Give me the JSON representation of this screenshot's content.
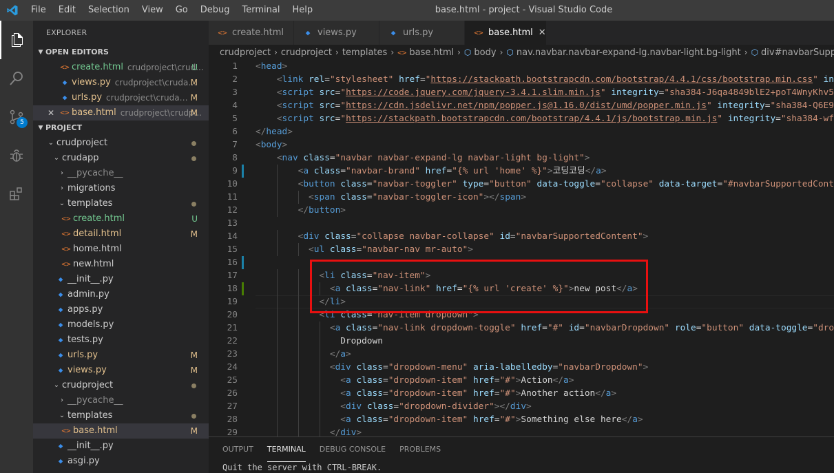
{
  "window": {
    "title": "base.html - project - Visual Studio Code"
  },
  "menu": [
    "File",
    "Edit",
    "Selection",
    "View",
    "Go",
    "Debug",
    "Terminal",
    "Help"
  ],
  "activity": {
    "scm_badge": "5"
  },
  "sidebar": {
    "title": "EXPLORER",
    "open_editors_header": "OPEN EDITORS",
    "open_editors": [
      {
        "label": "create.html",
        "desc": "crudproject\\crud...",
        "status": "U",
        "type": "html"
      },
      {
        "label": "views.py",
        "desc": "crudproject\\crudapp",
        "status": "M",
        "type": "py"
      },
      {
        "label": "urls.py",
        "desc": "crudproject\\crudapp",
        "status": "M",
        "type": "py"
      },
      {
        "label": "base.html",
        "desc": "crudproject\\crudp...",
        "status": "M",
        "type": "html"
      }
    ],
    "project_header": "PROJECT",
    "tree": [
      {
        "label": "crudproject",
        "kind": "folder"
      },
      {
        "label": "crudapp",
        "kind": "folder"
      },
      {
        "label": "__pycache__",
        "kind": "folder-closed"
      },
      {
        "label": "migrations",
        "kind": "folder-closed"
      },
      {
        "label": "templates",
        "kind": "folder"
      },
      {
        "label": "create.html",
        "kind": "html",
        "status": "U"
      },
      {
        "label": "detail.html",
        "kind": "html",
        "status": "M"
      },
      {
        "label": "home.html",
        "kind": "html"
      },
      {
        "label": "new.html",
        "kind": "html"
      },
      {
        "label": "__init__.py",
        "kind": "py"
      },
      {
        "label": "admin.py",
        "kind": "py"
      },
      {
        "label": "apps.py",
        "kind": "py"
      },
      {
        "label": "models.py",
        "kind": "py"
      },
      {
        "label": "tests.py",
        "kind": "py"
      },
      {
        "label": "urls.py",
        "kind": "py",
        "status": "M"
      },
      {
        "label": "views.py",
        "kind": "py",
        "status": "M"
      },
      {
        "label": "crudproject",
        "kind": "folder"
      },
      {
        "label": "__pycache__",
        "kind": "folder-closed"
      },
      {
        "label": "templates",
        "kind": "folder"
      },
      {
        "label": "base.html",
        "kind": "html",
        "status": "M"
      },
      {
        "label": "__init__.py",
        "kind": "py"
      },
      {
        "label": "asgi.py",
        "kind": "py"
      }
    ]
  },
  "tabs": [
    {
      "label": "create.html",
      "type": "html"
    },
    {
      "label": "views.py",
      "type": "py"
    },
    {
      "label": "urls.py",
      "type": "py"
    },
    {
      "label": "base.html",
      "type": "html",
      "active": true
    }
  ],
  "breadcrumb": [
    "crudproject",
    "crudproject",
    "templates",
    "base.html",
    "body",
    "nav.navbar.navbar-expand-lg.navbar-light.bg-light",
    "div#navbarSupportedCon"
  ],
  "code_lines": [
    {
      "n": "1",
      "text": "<head>"
    },
    {
      "n": "2",
      "text": "    <link rel=\"stylesheet\" href=\"https://stackpath.bootstrapcdn.com/bootstrap/4.4.1/css/bootstrap.min.css\" int"
    },
    {
      "n": "3",
      "text": "    <script src=\"https://code.jquery.com/jquery-3.4.1.slim.min.js\" integrity=\"sha384-J6qa4849blE2+poT4WnyKhv5"
    },
    {
      "n": "4",
      "text": "    <script src=\"https://cdn.jsdelivr.net/npm/popper.js@1.16.0/dist/umd/popper.min.js\" integrity=\"sha384-Q6E9"
    },
    {
      "n": "5",
      "text": "    <script src=\"https://stackpath.bootstrapcdn.com/bootstrap/4.4.1/js/bootstrap.min.js\" integrity=\"sha384-wf"
    },
    {
      "n": "6",
      "text": "</head>"
    },
    {
      "n": "7",
      "text": "<body>"
    },
    {
      "n": "8",
      "text": "    <nav class=\"navbar navbar-expand-lg navbar-light bg-light\">"
    },
    {
      "n": "9",
      "text": "        <a class=\"navbar-brand\" href=\"{% url 'home' %}\">코딩코딩</a>"
    },
    {
      "n": "10",
      "text": "        <button class=\"navbar-toggler\" type=\"button\" data-toggle=\"collapse\" data-target=\"#navbarSupportedCont"
    },
    {
      "n": "11",
      "text": "          <span class=\"navbar-toggler-icon\"></span>"
    },
    {
      "n": "12",
      "text": "        </button>"
    },
    {
      "n": "13",
      "text": ""
    },
    {
      "n": "14",
      "text": "        <div class=\"collapse navbar-collapse\" id=\"navbarSupportedContent\">"
    },
    {
      "n": "15",
      "text": "          <ul class=\"navbar-nav mr-auto\">"
    },
    {
      "n": "16",
      "text": ""
    },
    {
      "n": "17",
      "text": "            <li class=\"nav-item\">"
    },
    {
      "n": "18",
      "text": "              <a class=\"nav-link\" href=\"{% url 'create' %}\">new post</a>"
    },
    {
      "n": "19",
      "text": "            </li>"
    },
    {
      "n": "20",
      "text": "            <li class=\"nav-item dropdown\">"
    },
    {
      "n": "21",
      "text": "              <a class=\"nav-link dropdown-toggle\" href=\"#\" id=\"navbarDropdown\" role=\"button\" data-toggle=\"dro"
    },
    {
      "n": "22",
      "text": "                Dropdown"
    },
    {
      "n": "23",
      "text": "              </a>"
    },
    {
      "n": "24",
      "text": "              <div class=\"dropdown-menu\" aria-labelledby=\"navbarDropdown\">"
    },
    {
      "n": "25",
      "text": "                <a class=\"dropdown-item\" href=\"#\">Action</a>"
    },
    {
      "n": "26",
      "text": "                <a class=\"dropdown-item\" href=\"#\">Another action</a>"
    },
    {
      "n": "27",
      "text": "                <div class=\"dropdown-divider\"></div>"
    },
    {
      "n": "28",
      "text": "                <a class=\"dropdown-item\" href=\"#\">Something else here</a>"
    },
    {
      "n": "29",
      "text": "              </div>"
    }
  ],
  "panel": {
    "tabs": [
      "OUTPUT",
      "TERMINAL",
      "DEBUG CONSOLE",
      "PROBLEMS"
    ],
    "active": "TERMINAL",
    "terminal_text": "Quit the server with CTRL-BREAK."
  },
  "colors": {
    "accent": "#007acc",
    "modified": "#e2c08d",
    "untracked": "#73c991",
    "highlight_box": "#e81010"
  }
}
